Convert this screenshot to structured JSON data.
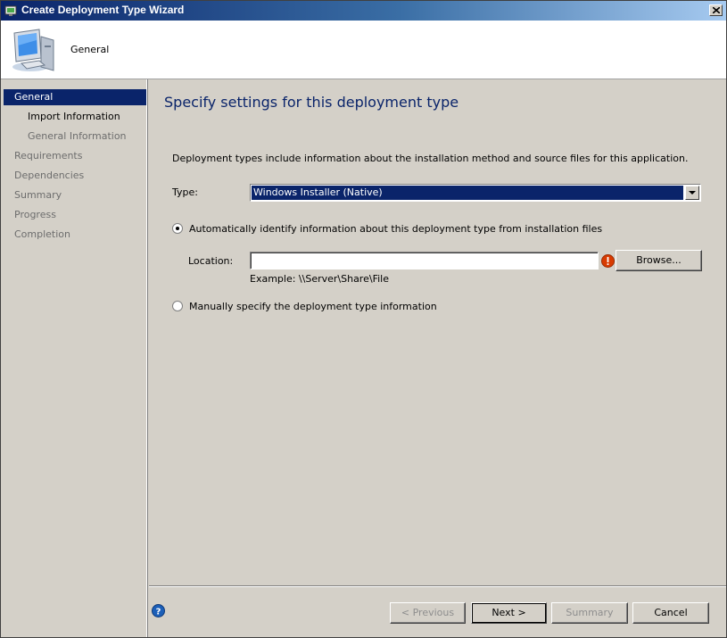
{
  "window": {
    "title": "Create Deployment Type Wizard"
  },
  "header": {
    "title": "General"
  },
  "sidebar": {
    "items": [
      {
        "label": "General"
      },
      {
        "label": "Import Information"
      },
      {
        "label": "General Information"
      },
      {
        "label": "Requirements"
      },
      {
        "label": "Dependencies"
      },
      {
        "label": "Summary"
      },
      {
        "label": "Progress"
      },
      {
        "label": "Completion"
      }
    ]
  },
  "main": {
    "title": "Specify settings for this deployment type",
    "description": "Deployment types include information about the installation method and source files for this application.",
    "type_label": "Type:",
    "type_value": "Windows Installer (Native)",
    "auto_option": "Automatically identify information about this deployment type from installation files",
    "location_label": "Location:",
    "location_value": "",
    "browse_label": "Browse...",
    "example": "Example: \\\\Server\\Share\\File",
    "manual_option": "Manually specify the deployment type information"
  },
  "footer": {
    "previous_label": "< Previous",
    "next_label": "Next >",
    "summary_label": "Summary",
    "cancel_label": "Cancel"
  },
  "colors": {
    "accent": "#0a246a",
    "title_text": "#0a246a",
    "warning": "#d83b01",
    "help": "#1c5fb8"
  },
  "icons": [
    "deployment-wizard-icon",
    "computer-icon",
    "close-icon",
    "dropdown-arrow-icon",
    "warning-icon",
    "help-icon"
  ]
}
